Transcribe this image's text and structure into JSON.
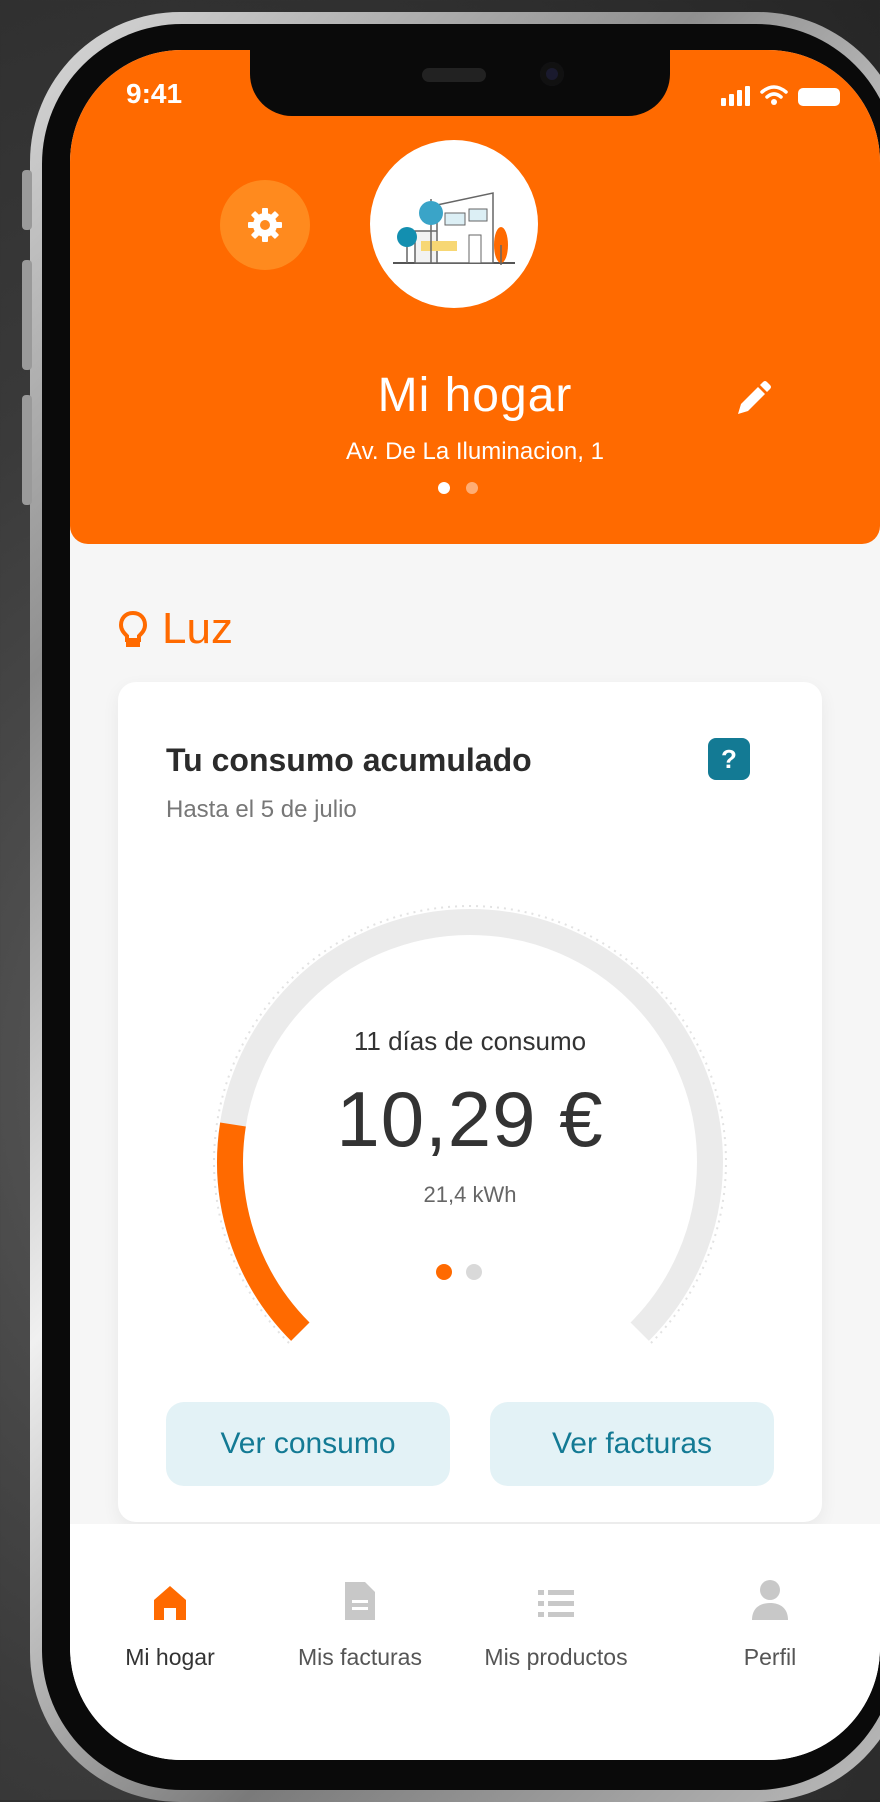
{
  "status_bar": {
    "time": "9:41"
  },
  "header": {
    "title": "Mi hogar",
    "address": "Av. De La Iluminacion, 1",
    "pager": {
      "count": 2,
      "active": 0
    }
  },
  "section": {
    "title": "Luz"
  },
  "card": {
    "title": "Tu consumo acumulado",
    "subtitle": "Hasta el 5 de julio",
    "help_label": "?",
    "gauge": {
      "days_label": "11 días de consumo",
      "amount": "10,29 €",
      "energy": "21,4 kWh",
      "progress_fraction": 0.2
    },
    "pager": {
      "count": 2,
      "active": 0
    },
    "buttons": {
      "consumption": "Ver consumo",
      "invoices": "Ver facturas"
    }
  },
  "tabbar": {
    "items": [
      {
        "label": "Mi hogar",
        "icon": "home-icon",
        "active": true
      },
      {
        "label": "Mis facturas",
        "icon": "document-icon",
        "active": false
      },
      {
        "label": "Mis productos",
        "icon": "list-icon",
        "active": false
      },
      {
        "label": "Perfil",
        "icon": "person-icon",
        "active": false
      }
    ]
  },
  "colors": {
    "brand_orange": "#ff6a00",
    "accent_teal": "#137a94",
    "button_bg": "#e3f2f6",
    "gauge_track": "#ebebeb",
    "inactive_icon": "#c8c8c8"
  }
}
